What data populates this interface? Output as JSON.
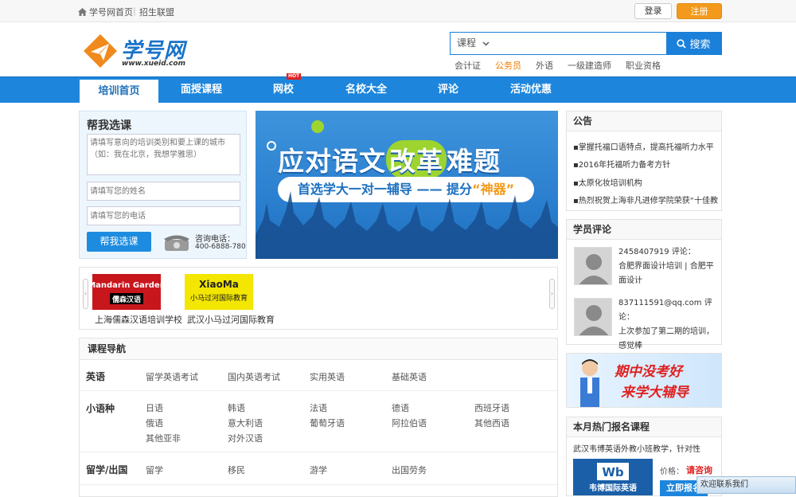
{
  "topbar": {
    "home_label": "学号网首页",
    "recruit_label": "招生联盟",
    "login_label": "登录",
    "register_label": "注册"
  },
  "header": {
    "logo_text": "学号网",
    "logo_url": "www.xueid.com",
    "search": {
      "category": "课程",
      "placeholder": "",
      "button_label": "搜索"
    },
    "hotwords": [
      {
        "label": "会计证",
        "highlight": false
      },
      {
        "label": "公务员",
        "highlight": true
      },
      {
        "label": "外语",
        "highlight": false
      },
      {
        "label": "一级建造师",
        "highlight": false
      },
      {
        "label": "职业资格",
        "highlight": false
      }
    ]
  },
  "nav": {
    "items": [
      {
        "label": "培训首页",
        "active": true
      },
      {
        "label": "面授课程",
        "active": false
      },
      {
        "label": "网校",
        "active": false,
        "badge": "HOT"
      },
      {
        "label": "名校大全",
        "active": false
      },
      {
        "label": "评论",
        "active": false
      },
      {
        "label": "活动优惠",
        "active": false
      }
    ]
  },
  "help": {
    "title": "帮我选课",
    "textarea_placeholder": "请填写意向的培训类别和要上课的城市（如：我在北京，我想学雅思）",
    "name_placeholder": "请填写您的姓名",
    "phone_placeholder": "请填写您的电话",
    "submit_label": "帮我选课",
    "consult_label": "咨询电话：",
    "consult_number": "400-6888-780"
  },
  "banner": {
    "line1_a": "应对语文",
    "line1_b": "改革",
    "line1_c": "难题",
    "line2_a": "首选学大一对一辅导 —— 提分",
    "line2_b": "“神器”"
  },
  "partners": [
    {
      "name": "上海儒森汉语培训学校",
      "logo_text": "Mandarin Garden",
      "logo_sub": "儒森汉语"
    },
    {
      "name": "武汉小马过河国际教育",
      "logo_text": "XiaoMa",
      "logo_sub": "小马过河国际教育"
    }
  ],
  "course_nav": {
    "title": "课程导航",
    "categories": [
      {
        "title": "英语",
        "items": [
          "留学英语考试",
          "国内英语考试",
          "实用英语",
          "基础英语"
        ]
      },
      {
        "title": "小语种",
        "items": [
          "日语",
          "韩语",
          "法语",
          "德语",
          "西班牙语",
          "俄语",
          "意大利语",
          "葡萄牙语",
          "阿拉伯语",
          "其他西语",
          "其他亚非",
          "对外汉语"
        ]
      },
      {
        "title": "留学/出国",
        "items": [
          "留学",
          "移民",
          "游学",
          "出国劳务"
        ]
      }
    ]
  },
  "notice": {
    "title": "公告",
    "items": [
      "掌握托福口语特点，提高托福听力水平",
      "2016年托福听力备考方针",
      "太原化妆培训机构",
      "热烈祝贺上海非凡进修学院荣获“十佳教"
    ]
  },
  "reviews": {
    "title": "学员评论",
    "items": [
      {
        "user": "2458407919",
        "verb": "评论：",
        "text": "合肥界面设计培训 | 合肥平面设计"
      },
      {
        "user": "837111591@qq.com",
        "verb": "评论：",
        "text": "上次参加了第二期的培训，感觉棒"
      }
    ]
  },
  "ad": {
    "line1": "期中没考好",
    "line2": "来学大辅导"
  },
  "hot_courses": {
    "title": "本月热门报名课程",
    "first_course": "武汉韦博英语外教小班教学，针对性",
    "logo_text": "韦博国际英语",
    "price_label": "价格：",
    "price_value": "请咨询",
    "signup_label": "立即报名"
  },
  "chat": {
    "label": "欢迎联系我们"
  },
  "colors": {
    "brand_blue": "#1d86dc",
    "accent_orange": "#f39a1c",
    "highlight_red": "#e02020"
  }
}
